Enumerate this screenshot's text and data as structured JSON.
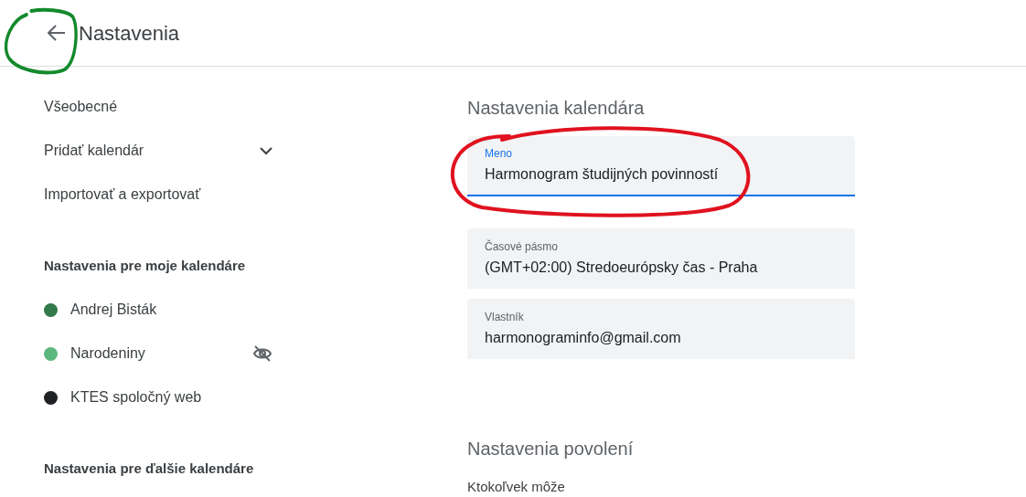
{
  "header": {
    "title": "Nastavenia"
  },
  "sidebar": {
    "items": [
      {
        "label": "Všeobecné",
        "kind": "link"
      },
      {
        "label": "Pridať kalendár",
        "kind": "expandable",
        "expanded": false
      },
      {
        "label": "Importovať a exportovať",
        "kind": "link"
      }
    ],
    "sections": [
      {
        "title": "Nastavenia pre moje kalendáre",
        "calendars": [
          {
            "name": "Andrej Bisták",
            "color": "#33794a",
            "hidden": false
          },
          {
            "name": "Narodeniny",
            "color": "#5cb77c",
            "hidden": true
          },
          {
            "name": "KTES spoločný web",
            "color": "#202124",
            "hidden": false
          }
        ]
      },
      {
        "title": "Nastavenia pre ďalšie kalendáre"
      }
    ]
  },
  "main": {
    "title": "Nastavenia kalendára",
    "fields": [
      {
        "label": "Meno",
        "value": "Harmonogram študijných povinností",
        "focused": true
      },
      {
        "label": "Časové pásmo",
        "value": "(GMT+02:00) Stredoeurópsky čas - Praha",
        "focused": false
      },
      {
        "label": "Vlastník",
        "value": "harmonograminfo@gmail.com",
        "focused": false
      }
    ],
    "permissions": {
      "title": "Nastavenia povolení",
      "subtitle": "Ktokoľvek môže"
    }
  }
}
